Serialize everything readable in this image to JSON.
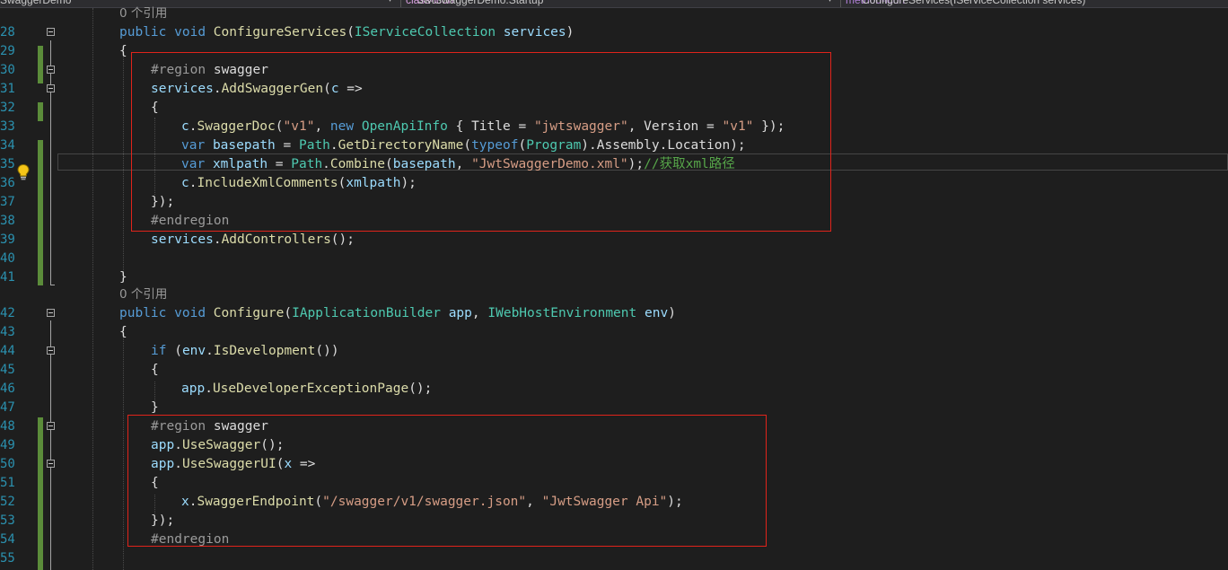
{
  "navbar": {
    "project": "SwaggerDemo",
    "class_scope": "JwtSwaggerDemo.Startup",
    "member_scope": "ConfigureServices(IServiceCollection services)",
    "dropdown_glyph": "▾",
    "class_icon": "class-icon",
    "member_icon": "method-icon"
  },
  "editor": {
    "codelens_configure_services": "0 个引用",
    "codelens_configure": "0 个引用",
    "line_numbers": [
      "28",
      "29",
      "30",
      "31",
      "32",
      "33",
      "34",
      "35",
      "36",
      "37",
      "38",
      "39",
      "40",
      "41",
      "42",
      "43",
      "44",
      "45",
      "46",
      "47",
      "48",
      "49",
      "50",
      "51",
      "52",
      "53",
      "54",
      "55"
    ],
    "colors": {
      "background": "#1e1e1e",
      "keyword": "#569cd6",
      "type": "#4ec9b0",
      "method": "#dcdcaa",
      "parameter": "#9cdcfe",
      "string": "#d69d85",
      "comment": "#57a64a",
      "line_number": "#2b91af",
      "change_marker": "#5b8c3a",
      "highlight_box": "#e0241b"
    }
  },
  "tokens": {
    "public": "public",
    "void": "void",
    "configure_services": "ConfigureServices",
    "iservice_collection": "IServiceCollection",
    "services": "services",
    "region": "#region",
    "swagger": "swagger",
    "endregion": "#endregion",
    "add_swagger_gen": "AddSwaggerGen",
    "c": "c",
    "arrow": "=>",
    "swagger_doc": "SwaggerDoc",
    "str_v1": "\"v1\"",
    "new": "new",
    "open_api_info": "OpenApiInfo",
    "title_prop": "Title",
    "str_jwtswagger": "\"jwtswagger\"",
    "version_prop": "Version",
    "var": "var",
    "basepath": "basepath",
    "path": "Path",
    "get_directory_name": "GetDirectoryName",
    "typeof": "typeof",
    "program": "Program",
    "assembly": "Assembly",
    "location": "Location",
    "xmlpath": "xmlpath",
    "combine": "Combine",
    "str_xml": "\"JwtSwaggerDemo.xml\"",
    "comment_xml": "//获取xml路径",
    "include_xml_comments": "IncludeXmlComments",
    "add_controllers": "AddControllers",
    "configure": "Configure",
    "iapplication_builder": "IApplicationBuilder",
    "app": "app",
    "iweb_host_environment": "IWebHostEnvironment",
    "env": "env",
    "if": "if",
    "is_development": "IsDevelopment",
    "use_developer_exception_page": "UseDeveloperExceptionPage",
    "use_swagger": "UseSwagger",
    "use_swagger_ui": "UseSwaggerUI",
    "x": "x",
    "swagger_endpoint": "SwaggerEndpoint",
    "str_endpoint": "\"/swagger/v1/swagger.json\"",
    "str_api": "\"JwtSwagger Api\""
  }
}
